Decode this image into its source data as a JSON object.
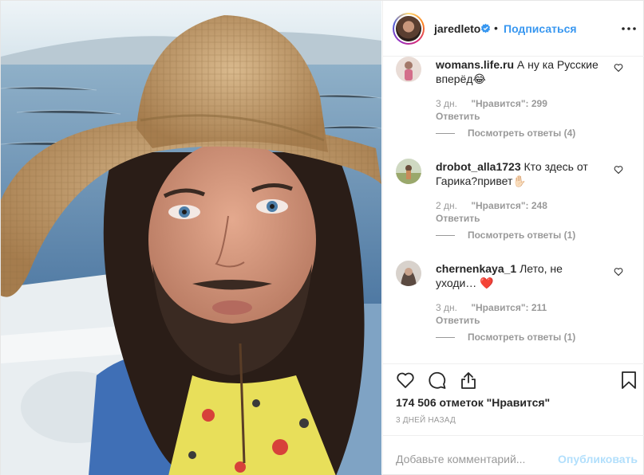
{
  "header": {
    "username": "jaredleto",
    "separator": "•",
    "follow_label": "Подписаться"
  },
  "comments": [
    {
      "user": "womans.life.ru",
      "text": "А ну ка Русские вперёд😂",
      "age": "3 дн.",
      "likes": "\"Нравится\": 299",
      "reply_label": "Ответить",
      "view_replies": "Посмотреть ответы (4)"
    },
    {
      "user": "drobot_alla1723",
      "text": "Кто здесь от Гарика?привет✋🏻",
      "age": "2 дн.",
      "likes": "\"Нравится\": 248",
      "reply_label": "Ответить",
      "view_replies": "Посмотреть ответы (1)"
    },
    {
      "user": "chernenkaya_1",
      "text": "Лето, не уходи… ❤️",
      "age": "3 дн.",
      "likes": "\"Нравится\": 211",
      "reply_label": "Ответить",
      "view_replies": "Посмотреть ответы (1)"
    }
  ],
  "footer": {
    "likes_count": "174 506 отметок \"Нравится\"",
    "date": "3 дней назад",
    "comment_placeholder": "Добавьте комментарий...",
    "publish_label": "Опубликовать"
  },
  "icons": {
    "verified": "verified-badge-icon",
    "more": "more-options-icon",
    "like": "heart-icon",
    "comment": "comment-icon",
    "share": "share-icon",
    "save": "bookmark-icon"
  },
  "colors": {
    "accent": "#3897f0",
    "muted": "#999999",
    "publish_disabled": "#b2dffc"
  }
}
